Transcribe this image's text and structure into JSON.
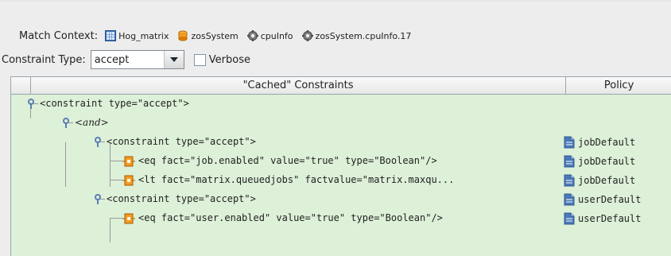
{
  "match_context": {
    "label": "Match Context:",
    "items": [
      {
        "name": "Hog_matrix",
        "icon": "grid-icon"
      },
      {
        "name": "zosSystem",
        "icon": "orange-cylinder-icon"
      },
      {
        "name": "cpuInfo",
        "icon": "gear-icon"
      },
      {
        "name": "zosSystem.cpuInfo.17",
        "icon": "gear-icon"
      }
    ]
  },
  "constraint_type": {
    "label": "Constraint Type:",
    "selected": "accept",
    "verbose_label": "Verbose",
    "verbose_checked": false
  },
  "table": {
    "columns": [
      "\"Cached\" Constraints",
      "Policy"
    ],
    "rows": [
      {
        "text": "<constraint type=\"accept\">",
        "policy": ""
      },
      {
        "text": "<and>",
        "policy": ""
      },
      {
        "text": "<constraint type=\"accept\">",
        "policy": "jobDefault"
      },
      {
        "text": "<eq fact=\"job.enabled\" value=\"true\" type=\"Boolean\"/>",
        "policy": "jobDefault"
      },
      {
        "text": "<lt fact=\"matrix.queuedjobs\" factvalue=\"matrix.maxqu...",
        "policy": "jobDefault"
      },
      {
        "text": "<constraint type=\"accept\">",
        "policy": "userDefault"
      },
      {
        "text": "<eq fact=\"user.enabled\" value=\"true\" type=\"Boolean\"/>",
        "policy": "userDefault"
      }
    ]
  },
  "colors": {
    "tree_background": "#ddf0d8",
    "key_icon": "#5b7fb5",
    "node_icon": "#f08c1e",
    "doc_icon": "#4a79b8"
  }
}
